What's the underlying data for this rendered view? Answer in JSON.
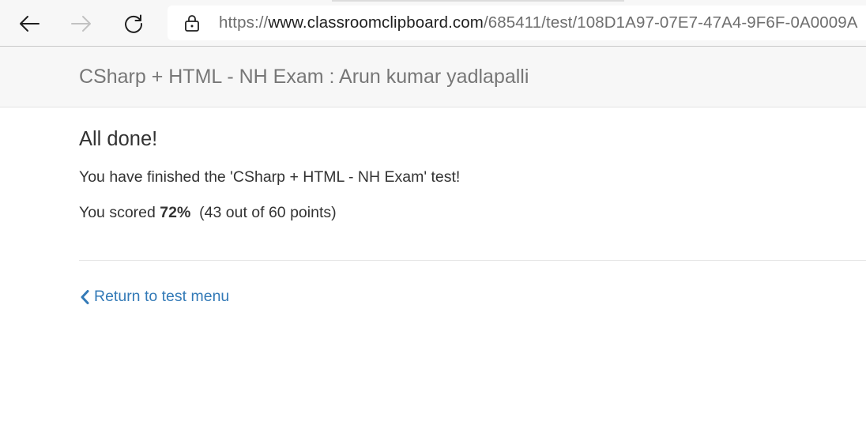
{
  "browser": {
    "url_scheme": "https://",
    "url_host": "www.classroomclipboard.com",
    "url_path": "/685411/test/108D1A97-07E7-47A4-9F6F-0A0009A",
    "icons": {
      "back": "arrow-left-icon",
      "forward": "arrow-right-icon",
      "refresh": "refresh-icon",
      "lock": "lock-icon"
    }
  },
  "header": {
    "title": "CSharp + HTML - NH Exam : Arun kumar yadlapalli"
  },
  "result": {
    "heading": "All done!",
    "finished_message": "You have finished the 'CSharp + HTML - NH Exam' test!",
    "score_prefix": "You scored ",
    "score_percent": "72%",
    "score_detail": "(43 out of 60 points)"
  },
  "navigation": {
    "return_label": "Return to test menu",
    "return_icon": "chevron-left-icon"
  },
  "colors": {
    "link": "#337ab7",
    "header_bg": "#f7f7f7",
    "title_text": "#777777",
    "body_text": "#333333"
  }
}
